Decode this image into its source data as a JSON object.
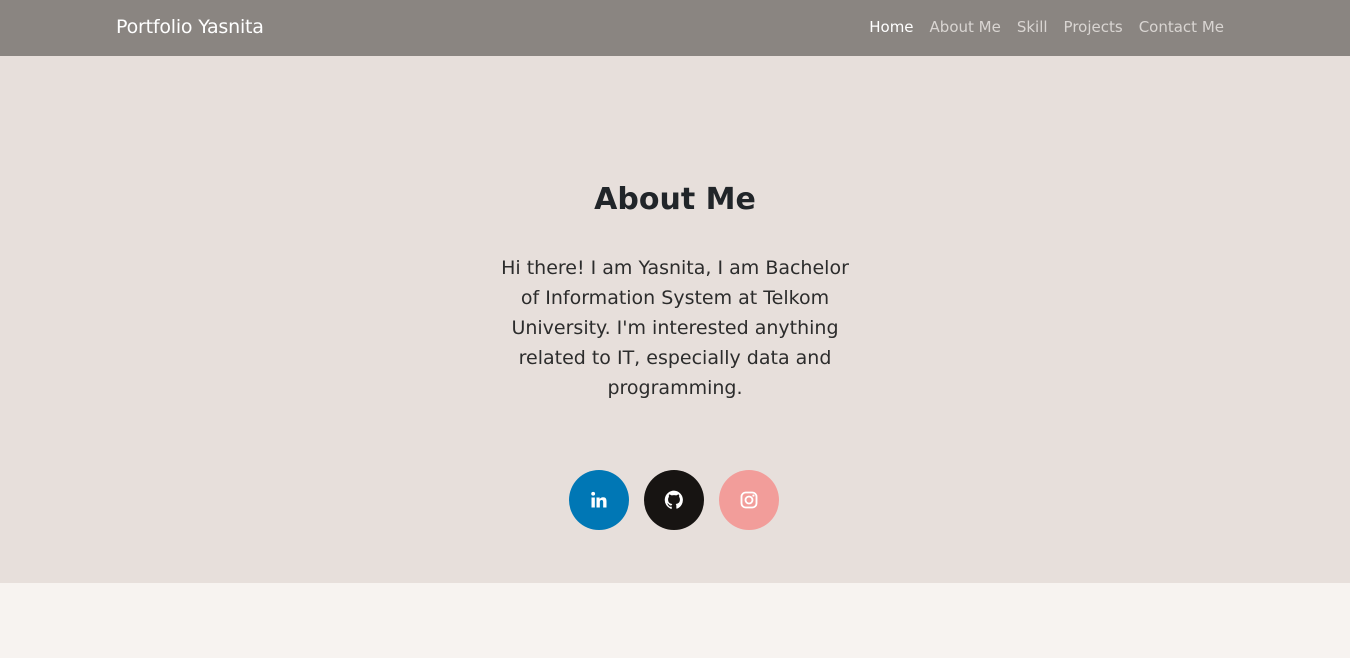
{
  "navbar": {
    "brand": "Portfolio Yasnita",
    "links": [
      {
        "label": "Home",
        "active": true
      },
      {
        "label": "About Me",
        "active": false
      },
      {
        "label": "Skill",
        "active": false
      },
      {
        "label": "Projects",
        "active": false
      },
      {
        "label": "Contact Me",
        "active": false
      }
    ]
  },
  "hero": {
    "title": "About Me",
    "bio": "Hi there! I am Yasnita, I am Bachelor of Information System at Telkom University. I'm interested anything related to IT, especially data and programming."
  },
  "socials": [
    {
      "icon": "linkedin-icon",
      "color": "#0077b5"
    },
    {
      "icon": "github-icon",
      "color": "#171412"
    },
    {
      "icon": "instagram-icon",
      "color": "#f29d9a"
    }
  ],
  "colors": {
    "navbar": "#8a8581",
    "hero_background": "#e7dfdb",
    "page_background": "#f7f3f0"
  }
}
